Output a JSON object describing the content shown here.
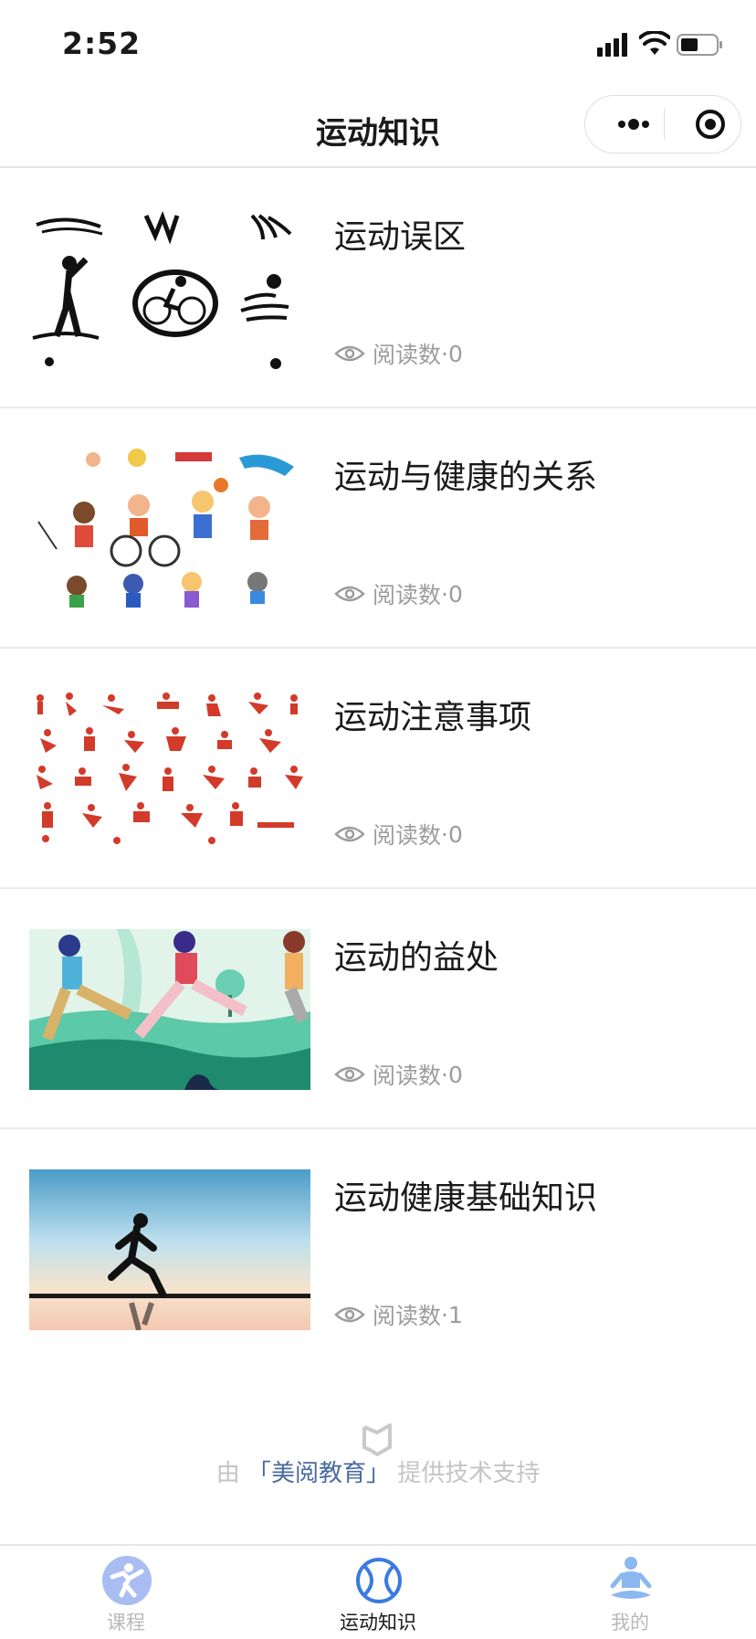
{
  "status_bar": {
    "time": "2:52"
  },
  "nav": {
    "title": "运动知识"
  },
  "articles": [
    {
      "title": "运动误区",
      "reads_label": "阅读数",
      "reads_sep": "·",
      "reads": "0"
    },
    {
      "title": "运动与健康的关系",
      "reads_label": "阅读数",
      "reads_sep": "·",
      "reads": "0"
    },
    {
      "title": "运动注意事项",
      "reads_label": "阅读数",
      "reads_sep": "·",
      "reads": "0"
    },
    {
      "title": "运动的益处",
      "reads_label": "阅读数",
      "reads_sep": "·",
      "reads": "0"
    },
    {
      "title": "运动健康基础知识",
      "reads_label": "阅读数",
      "reads_sep": "·",
      "reads": "1"
    }
  ],
  "footer": {
    "prefix": "由",
    "brand": "「美阅教育」",
    "suffix": "提供技术支持"
  },
  "tabs": [
    {
      "label": "课程",
      "icon": "course-icon"
    },
    {
      "label": "运动知识",
      "icon": "ball-icon"
    },
    {
      "label": "我的",
      "icon": "meditation-icon"
    }
  ],
  "colors": {
    "accent": "#3a7be0",
    "inactive": "#b8b8b8",
    "tab_icon_bg": "#a9bdf2"
  }
}
